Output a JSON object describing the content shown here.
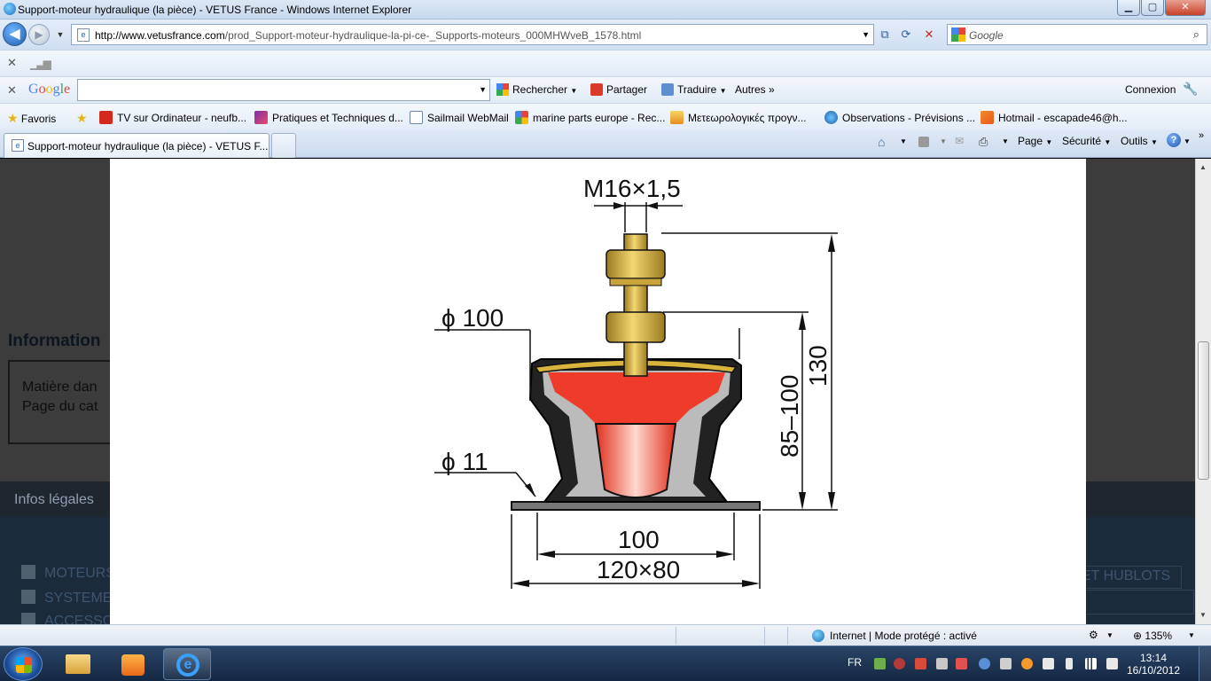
{
  "window": {
    "title": "Support-moteur hydraulique (la pièce) - VETUS France - Windows Internet Explorer",
    "minimize": "▁",
    "maximize": "▢",
    "close": "✕"
  },
  "nav": {
    "url_host": "http://www.vetusfrance.com",
    "url_path": "/prod_Support-moteur-hydraulique-la-pi-ce-_Supports-moteurs_000MHWveB_1578.html",
    "search_placeholder": "Google"
  },
  "toolbar_google": {
    "logo": "Google",
    "search_value": "",
    "rechercher": "Rechercher",
    "partager": "Partager",
    "traduire": "Traduire",
    "autres": "Autres »",
    "connexion": "Connexion"
  },
  "favorites": {
    "label": "Favoris",
    "items": [
      "TV sur Ordinateur - neufb...",
      "Pratiques et Techniques d...",
      "Sailmail WebMail",
      "marine parts europe - Rec...",
      "Μετεωρολογικές προγν...",
      "Observations - Prévisions ...",
      "Hotmail - escapade46@h..."
    ]
  },
  "tabs": {
    "active": "Support-moteur hydraulique (la pièce) - VETUS F..."
  },
  "commandbar": {
    "page": "Page",
    "securite": "Sécurité",
    "outils": "Outils",
    "help": "?"
  },
  "page": {
    "info_heading": "Information",
    "info_line1": "Matière dan",
    "info_line2": "Page du cat",
    "legal": "Infos légales",
    "categories": [
      "MOTEURS",
      "SYSTEME",
      "ACCESSO"
    ],
    "hublots": "ET HUBLOTS"
  },
  "drawing": {
    "thread": "M16×1,5",
    "dia_top": "ϕ 100",
    "dia_hole": "ϕ 11",
    "height_total": "130",
    "height_range": "85–100",
    "width_inner": "100",
    "width_base": "120×80"
  },
  "status": {
    "zone": "Internet | Mode protégé : activé",
    "zoom": "135%"
  },
  "taskbar": {
    "lang": "FR",
    "time": "13:14",
    "date": "16/10/2012"
  },
  "colors": {
    "rubber_red": "#ee3b2a",
    "brass": "#d8b43c",
    "page_bg": "#3c3c3c"
  }
}
